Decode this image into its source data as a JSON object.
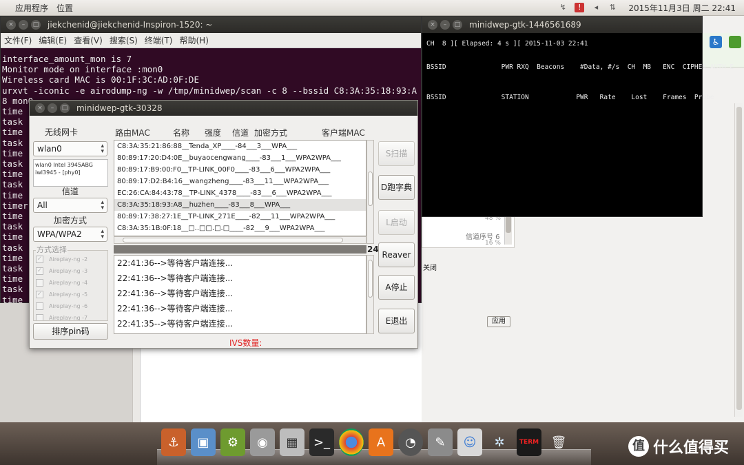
{
  "top_panel": {
    "menus": [
      "应用程序",
      "位置"
    ],
    "clock": "2015年11月3日 周二 22:41"
  },
  "terminal": {
    "title": "jiekchenid@jiekchenid-Inspiron-1520: ~",
    "menu": [
      "文件(F)",
      "编辑(E)",
      "查看(V)",
      "搜索(S)",
      "终端(T)",
      "帮助(H)"
    ],
    "lines": [
      "interface_amount_mon is 7",
      "Monitor mode on interface :mon0",
      "Wireless card MAC is 00:1F:3C:AD:0F:DE",
      "urxvt -iconic -e airodump-ng -w /tmp/minidwep/scan -c 8 --bssid C8:3A:35:18:93:A",
      "8 mon0",
      "time",
      "task",
      "time",
      "task",
      "time",
      "task",
      "time",
      "task",
      "time",
      "timer",
      "time",
      "task",
      "time",
      "task",
      "time",
      "task",
      "time",
      "task",
      "time",
      "task",
      "time",
      "task"
    ]
  },
  "airodump": {
    "title": "minidwep-gtk-1446561689",
    "header": "CH  8 ][ Elapsed: 4 s ][ 2015-11-03 22:41",
    "ap_columns": "BSSID              PWR RXQ  Beacons    #Data, #/s  CH  MB   ENC  CIPHER AUTH E",
    "station_columns": "BSSID              STATION            PWR   Rate    Lost    Frames  Probe"
  },
  "settings_bg": {
    "pct_a": "48 %",
    "channel_label": "信道序号 6",
    "pct_b": "16 %",
    "close_label": "关闭",
    "apply_label": "应用"
  },
  "dialog": {
    "title": "minidwep-gtk-30328",
    "card_label": "无线网卡",
    "card_value": "wlan0",
    "card_info": "wlan0 Intel 3945ABG\niwl3945 - [phy0]",
    "channel_label": "信道",
    "channel_value": "All",
    "enc_label": "加密方式",
    "enc_value": "WPA/WPA2",
    "mode_title": "方式选择",
    "modes": [
      {
        "label": "Aireplay-ng -2",
        "checked": true
      },
      {
        "label": "Aireplay-ng -3",
        "checked": true
      },
      {
        "label": "Aireplay-ng -4",
        "checked": false
      },
      {
        "label": "Aireplay-ng -5",
        "checked": true
      },
      {
        "label": "Aireplay-ng -6",
        "checked": false
      },
      {
        "label": "Aireplay-ng -7",
        "checked": false
      }
    ],
    "pin_button": "排序pin码",
    "columns": [
      "路由MAC",
      "名称",
      "强度",
      "信道",
      "加密方式",
      "客户端MAC"
    ],
    "aps": [
      "C8:3A:35:21:86:88__Tenda_XP____-84___3___WPA___",
      "80:89:17:20:D4:0E__buyaocengwang____-83___1___WPA2WPA___",
      "80:89:17:B9:00:F0__TP-LINK_00F0____-83___6___WPA2WPA___",
      "80:89:17:D2:B4:16__wangzheng____-83___11___WPA2WPA___",
      "EC:26:CA:84:43:78__TP-LINK_4378____-83___6___WPA2WPA___",
      "C8:3A:35:18:93:A8__huzhen____-83___8___WPA___",
      "80:89:17:38:27:1E__TP-LINK_271E____-82___11___WPA2WPA___",
      "C8:3A:35:1B:0F:18__□..□□.□.□____-82___9___WPA2WPA___"
    ],
    "selected_index": 5,
    "progress_value": "24",
    "logs": [
      "22:41:36-->等待客户端连接...",
      "22:41:36-->等待客户端连接...",
      "22:41:36-->等待客户端连接...",
      "22:41:36-->等待客户端连接...",
      "22:41:35-->等待客户端连接..."
    ],
    "ivs_label": "IVS数量:",
    "buttons": {
      "scan": "S扫描",
      "dict": "D跑字典",
      "start": "L启动",
      "reaver": "Reaver",
      "stop": "A停止",
      "exit": "E退出"
    }
  },
  "dock": {
    "items": [
      "anchor-icon",
      "image-viewer-icon",
      "software-center-icon",
      "camera-icon",
      "calculator-icon",
      "terminal-icon",
      "chrome-icon",
      "archive-icon",
      "system-monitor-icon",
      "settings-icon",
      "messenger-icon",
      "network-icon",
      "xterm-icon",
      "trash-icon"
    ],
    "watermark": "什么值得买",
    "xterm_label": "TERM"
  }
}
